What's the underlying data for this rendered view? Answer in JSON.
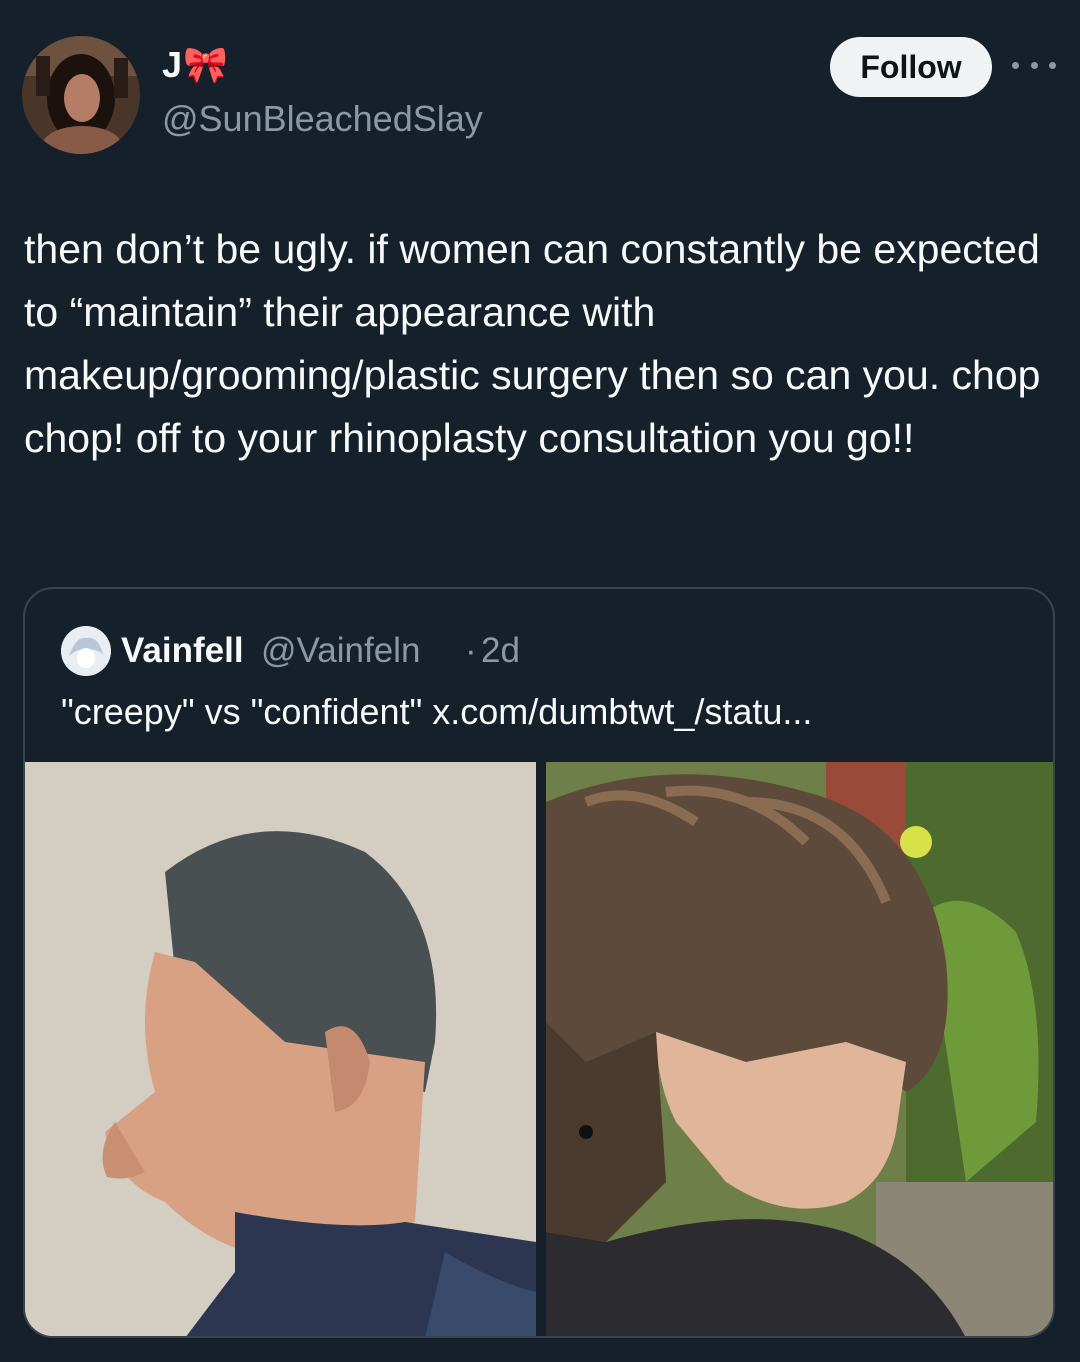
{
  "tweet": {
    "author": {
      "display_name": "J🎀",
      "handle": "@SunBleachedSlay"
    },
    "follow_label": "Follow",
    "more_icon": "more-horizontal-icon",
    "text": "then don’t be ugly. if women can constantly be expected to “maintain” their appearance with makeup/grooming/plastic surgery then so can you. chop chop! off to your rhinoplasty consultation you go!!"
  },
  "quote": {
    "display_name": "Vainfell",
    "handle": "@Vainfeln",
    "separator": "·",
    "time": "2d",
    "text": "\"creepy\" vs \"confident\" x.com/dumbtwt_/statu...",
    "media": [
      {
        "description_icon": "photo-icon"
      },
      {
        "description_icon": "photo-icon"
      }
    ]
  },
  "colors": {
    "background": "#15202b",
    "text_primary": "#f7f9f9",
    "text_secondary": "#8b98a5",
    "border": "#38444d",
    "follow_bg": "#eff3f4"
  }
}
